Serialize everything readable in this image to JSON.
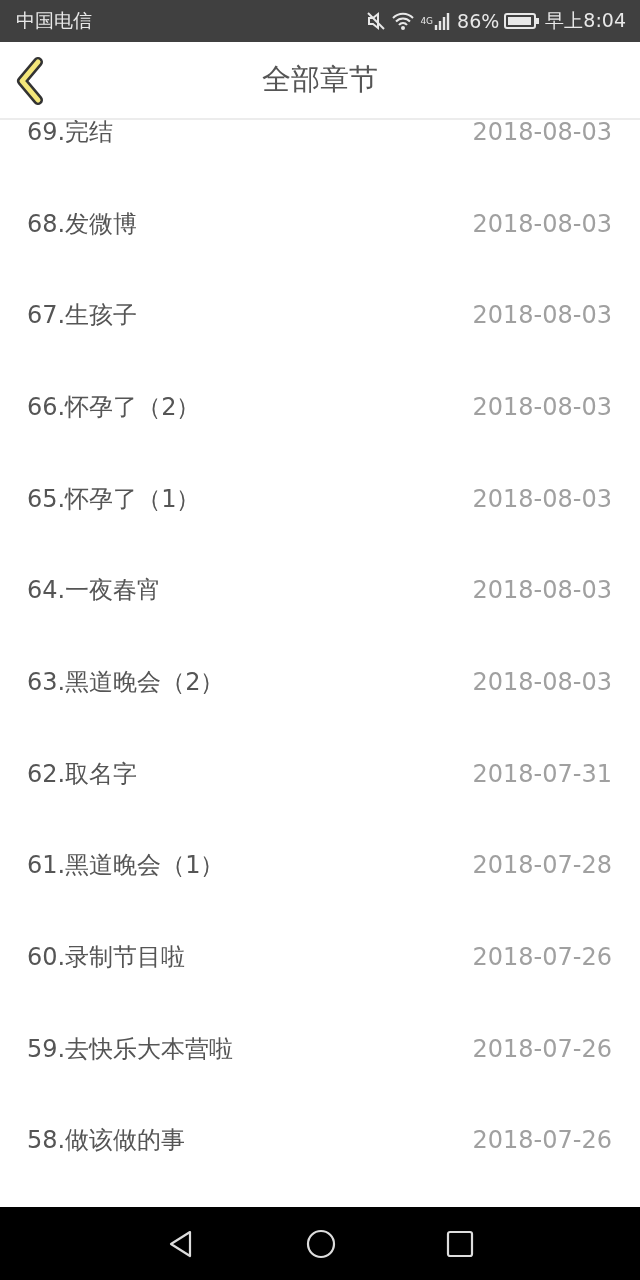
{
  "status_bar": {
    "carrier": "中国电信",
    "network": "4G",
    "battery": "86%",
    "time": "早上8:04"
  },
  "header": {
    "title": "全部章节"
  },
  "chapters": [
    {
      "title": "69.完结",
      "date": "2018-08-03"
    },
    {
      "title": "68.发微博",
      "date": "2018-08-03"
    },
    {
      "title": "67.生孩子",
      "date": "2018-08-03"
    },
    {
      "title": "66.怀孕了（2）",
      "date": "2018-08-03"
    },
    {
      "title": "65.怀孕了（1）",
      "date": "2018-08-03"
    },
    {
      "title": "64.一夜春宵",
      "date": "2018-08-03"
    },
    {
      "title": "63.黑道晚会（2）",
      "date": "2018-08-03"
    },
    {
      "title": "62.取名字",
      "date": "2018-07-31"
    },
    {
      "title": "61.黑道晚会（1）",
      "date": "2018-07-28"
    },
    {
      "title": "60.录制节目啦",
      "date": "2018-07-26"
    },
    {
      "title": "59.去快乐大本营啦",
      "date": "2018-07-26"
    },
    {
      "title": "58.做该做的事",
      "date": "2018-07-26"
    }
  ]
}
